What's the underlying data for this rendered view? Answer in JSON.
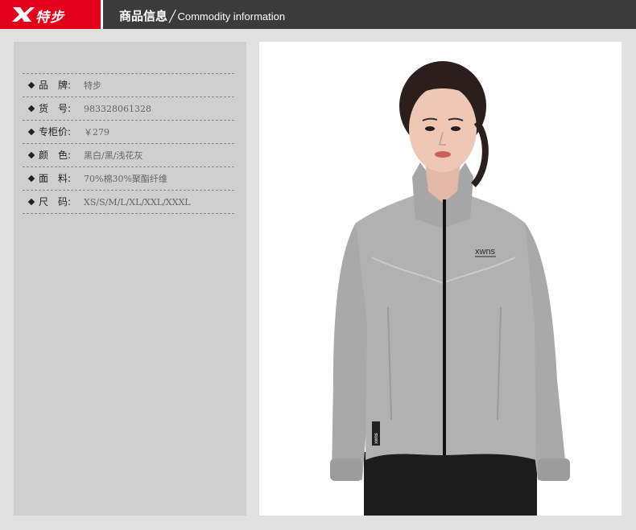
{
  "header": {
    "brand": "特步",
    "title_zh": "商品信息",
    "slash": "╱",
    "title_en": "Commodity information",
    "brand_color": "#e2001a"
  },
  "product_info": {
    "rows": [
      {
        "label": "品　牌:",
        "value": "特步"
      },
      {
        "label": "货　号:",
        "value": "983328061328"
      },
      {
        "label": "专柜价:",
        "value": "￥279"
      },
      {
        "label": "颜　色:",
        "value": "黑白/黑/浅花灰"
      },
      {
        "label": "面　料:",
        "value": "70%棉30%聚酯纤维"
      },
      {
        "label": "尺　码:",
        "value": "XS/S/M/L/XL/XXL/XXXL"
      }
    ]
  },
  "photo": {
    "chest_logo": "xwns",
    "tag_text": "xwns"
  }
}
